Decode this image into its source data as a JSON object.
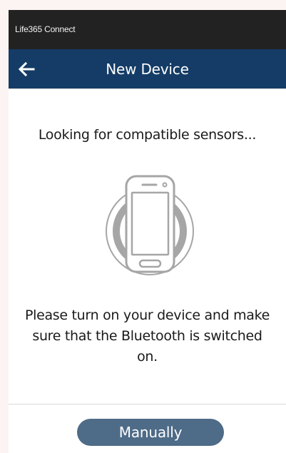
{
  "status_bar": {
    "app_name": "Life365 Connect"
  },
  "header": {
    "title": "New Device",
    "back_icon": "arrow-left-icon"
  },
  "main": {
    "searching_text": "Looking for compatible sensors...",
    "illustration_icon": "smartphone-scanning-icon",
    "instructions": "Please turn on your device and make sure that the Bluetooth is switched on."
  },
  "footer": {
    "manual_button_label": "Manually"
  },
  "colors": {
    "status_bar": "#222222",
    "nav_bar": "#143c66",
    "button": "#4e6b87",
    "text": "#1a1a1a",
    "illustration_stroke": "#a6a6a6"
  }
}
